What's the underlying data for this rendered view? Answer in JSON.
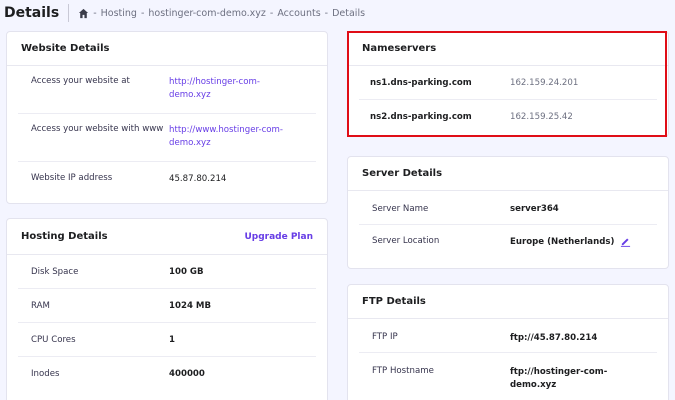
{
  "header": {
    "title": "Details",
    "breadcrumb": [
      "Hosting",
      "hostinger-com-demo.xyz",
      "Accounts",
      "Details"
    ],
    "separator": "-"
  },
  "website": {
    "title": "Website Details",
    "rows": [
      {
        "label": "Access your website at",
        "value": "http://hostinger-com-demo.xyz"
      },
      {
        "label": "Access your website with www",
        "value": "http://www.hostinger-com-demo.xyz"
      },
      {
        "label": "Website IP address",
        "value": "45.87.80.214"
      }
    ]
  },
  "hosting": {
    "title": "Hosting Details",
    "action": "Upgrade Plan",
    "rows": [
      {
        "label": "Disk Space",
        "value": "100 GB"
      },
      {
        "label": "RAM",
        "value": "1024 MB"
      },
      {
        "label": "CPU Cores",
        "value": "1"
      },
      {
        "label": "Inodes",
        "value": "400000"
      }
    ]
  },
  "nameservers": {
    "title": "Nameservers",
    "rows": [
      {
        "label": "ns1.dns-parking.com",
        "value": "162.159.24.201"
      },
      {
        "label": "ns2.dns-parking.com",
        "value": "162.159.25.42"
      }
    ]
  },
  "server": {
    "title": "Server Details",
    "rows": [
      {
        "label": "Server Name",
        "value": "server364"
      },
      {
        "label": "Server Location",
        "value": "Europe (Netherlands)"
      }
    ]
  },
  "ftp": {
    "title": "FTP Details",
    "rows": [
      {
        "label": "FTP IP",
        "value": "ftp://45.87.80.214"
      },
      {
        "label": "FTP Hostname",
        "value": "ftp://hostinger-com-demo.xyz"
      }
    ]
  },
  "colors": {
    "accent": "#673de6",
    "highlight": "#e00d17",
    "background": "#f4f5ff"
  },
  "icons": {
    "breadcrumb_home": "home-icon",
    "server_location_edit": "pencil-icon"
  }
}
